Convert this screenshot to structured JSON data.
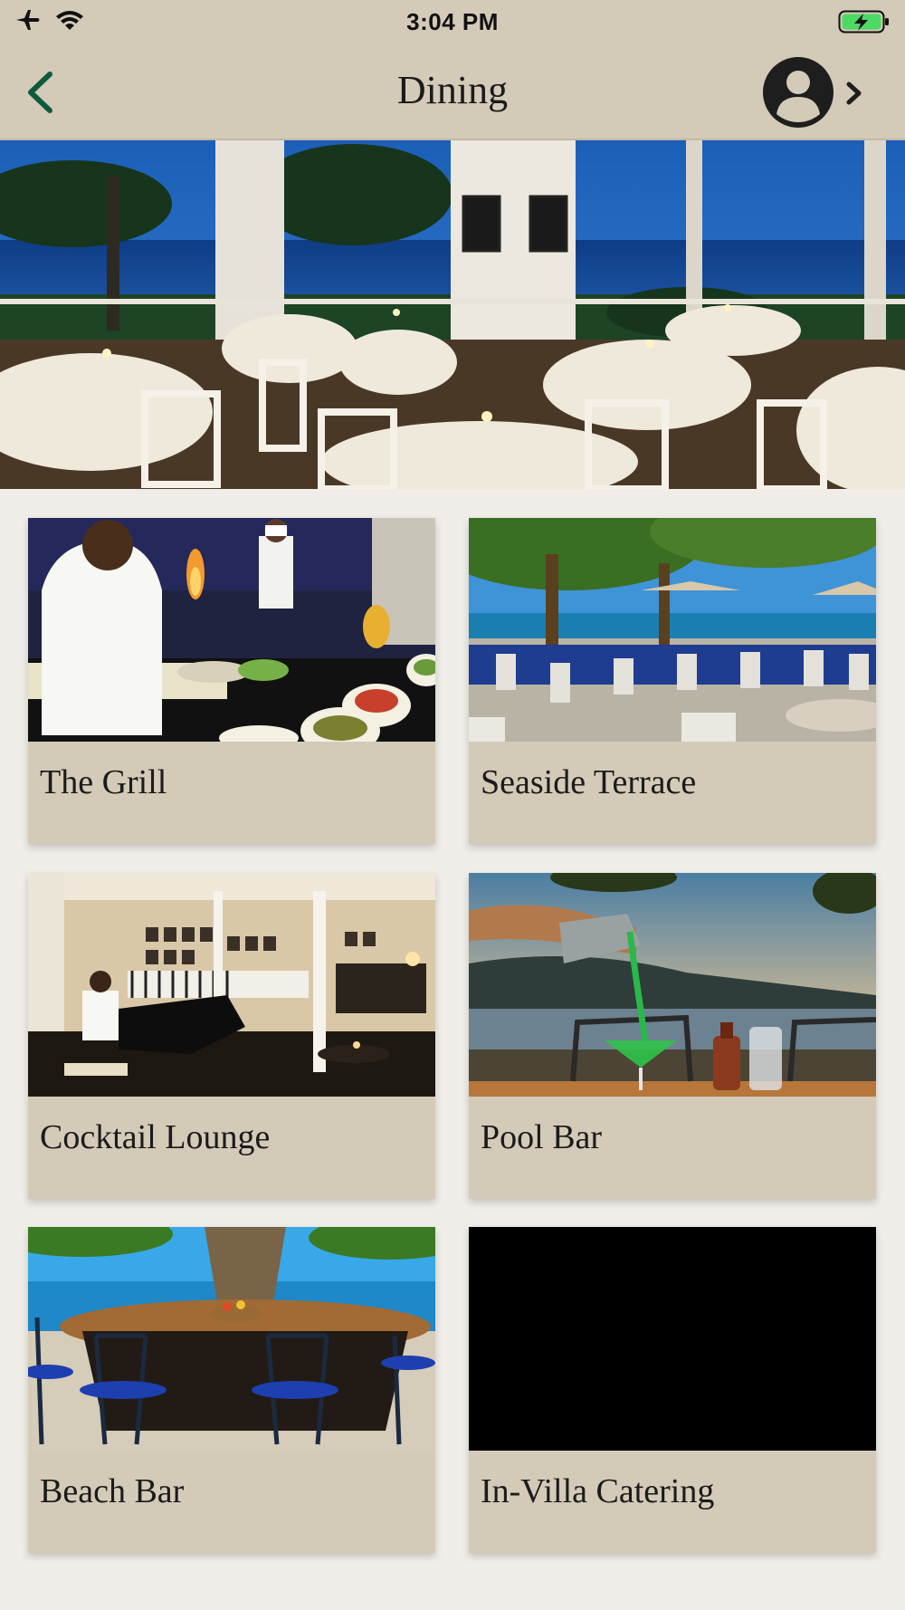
{
  "status_bar": {
    "time": "3:04 PM",
    "left_icons": [
      "airplane-icon",
      "wifi-icon"
    ],
    "right_icons": [
      "battery-charging-icon"
    ],
    "battery_color": "#4cd964"
  },
  "nav": {
    "title": "Dining",
    "back_icon": "chevron-left-icon",
    "profile_icon": "user-circle-icon",
    "accent_color": "#0e5a3c"
  },
  "hero": {
    "image": "open-air-oceanfront-dining-terrace-at-dusk"
  },
  "venues": [
    {
      "label": "The Grill",
      "image": "chef-at-grill-station"
    },
    {
      "label": "Seaside Terrace",
      "image": "beachfront-terrace-tables-with-umbrellas"
    },
    {
      "label": "Cocktail Lounge",
      "image": "piano-lounge-interior"
    },
    {
      "label": "Pool Bar",
      "image": "green-cocktail-poured-at-sunset"
    },
    {
      "label": "Beach Bar",
      "image": "round-beach-bar-under-tree"
    },
    {
      "label": "In-Villa Catering",
      "image": "black-placeholder"
    }
  ]
}
